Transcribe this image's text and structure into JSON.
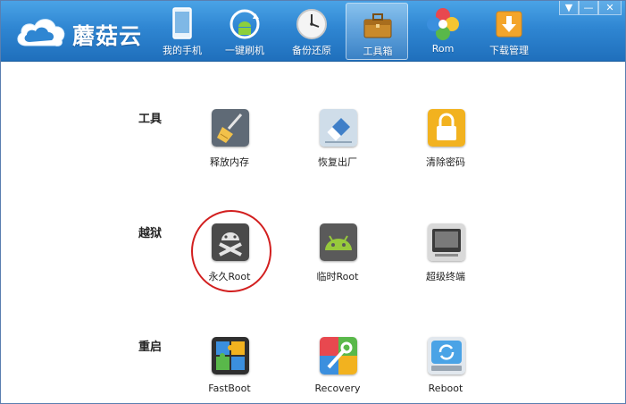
{
  "app": {
    "name": "蘑菇云"
  },
  "nav": {
    "items": [
      {
        "label": "我的手机",
        "icon": "phone-icon"
      },
      {
        "label": "一键刷机",
        "icon": "android-refresh-icon"
      },
      {
        "label": "备份还原",
        "icon": "clock-icon"
      },
      {
        "label": "工具箱",
        "icon": "toolbox-icon",
        "active": true
      },
      {
        "label": "Rom",
        "icon": "rom-petals-icon"
      },
      {
        "label": "下载管理",
        "icon": "download-icon"
      }
    ]
  },
  "window_controls": {
    "menu": "▼",
    "minimize": "—",
    "close": "✕"
  },
  "sections": {
    "tools": {
      "label": "工具",
      "items": [
        {
          "label": "释放内存",
          "icon": "broom-icon"
        },
        {
          "label": "恢复出厂",
          "icon": "eraser-icon"
        },
        {
          "label": "清除密码",
          "icon": "lock-icon"
        }
      ]
    },
    "jailbreak": {
      "label": "越狱",
      "items": [
        {
          "label": "永久Root",
          "icon": "android-crossbones-icon"
        },
        {
          "label": "临时Root",
          "icon": "android-green-icon"
        },
        {
          "label": "超级终端",
          "icon": "terminal-icon"
        }
      ]
    },
    "reboot": {
      "label": "重启",
      "items": [
        {
          "label": "FastBoot",
          "icon": "puzzle-icon"
        },
        {
          "label": "Recovery",
          "icon": "wrench-icon"
        },
        {
          "label": "Reboot",
          "icon": "refresh-drive-icon"
        }
      ]
    }
  },
  "colors": {
    "header_top": "#4aa3e6",
    "header_bottom": "#1f6fbc",
    "highlight": "#d21f1f"
  }
}
